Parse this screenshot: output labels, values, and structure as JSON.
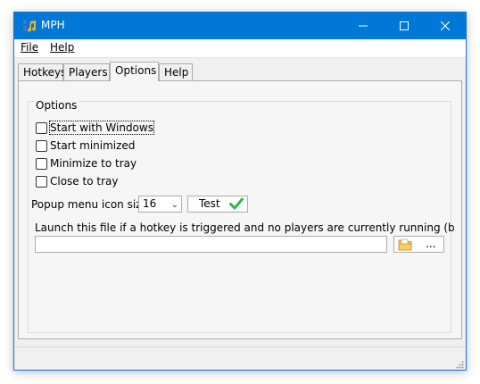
{
  "window": {
    "title": "MPH"
  },
  "menu": {
    "file": "File",
    "help": "Help"
  },
  "tabs": [
    "Hotkeys",
    "Players",
    "Options",
    "Help"
  ],
  "active_tab": "Options",
  "options": {
    "group_title": "Options",
    "checkboxes": [
      {
        "label": "Start with Windows",
        "checked": false
      },
      {
        "label": "Start minimized",
        "checked": false
      },
      {
        "label": "Minimize to tray",
        "checked": false
      },
      {
        "label": "Close to tray",
        "checked": false
      }
    ],
    "icon_size_label": "Popup menu icon size:",
    "icon_size_value": "16",
    "test_button": "Test",
    "launch_label": "Launch this file if a hotkey is triggered and no players are currently running (blank to disable):",
    "launch_value": "",
    "browse_button": "..."
  },
  "colors": {
    "titlebar": "#0078d7",
    "accent_check": "#2fb84a"
  },
  "icons": [
    "app-music-icon",
    "minimize-icon",
    "maximize-icon",
    "close-icon",
    "checkmark-icon",
    "folder-icon",
    "resize-grip-icon"
  ]
}
